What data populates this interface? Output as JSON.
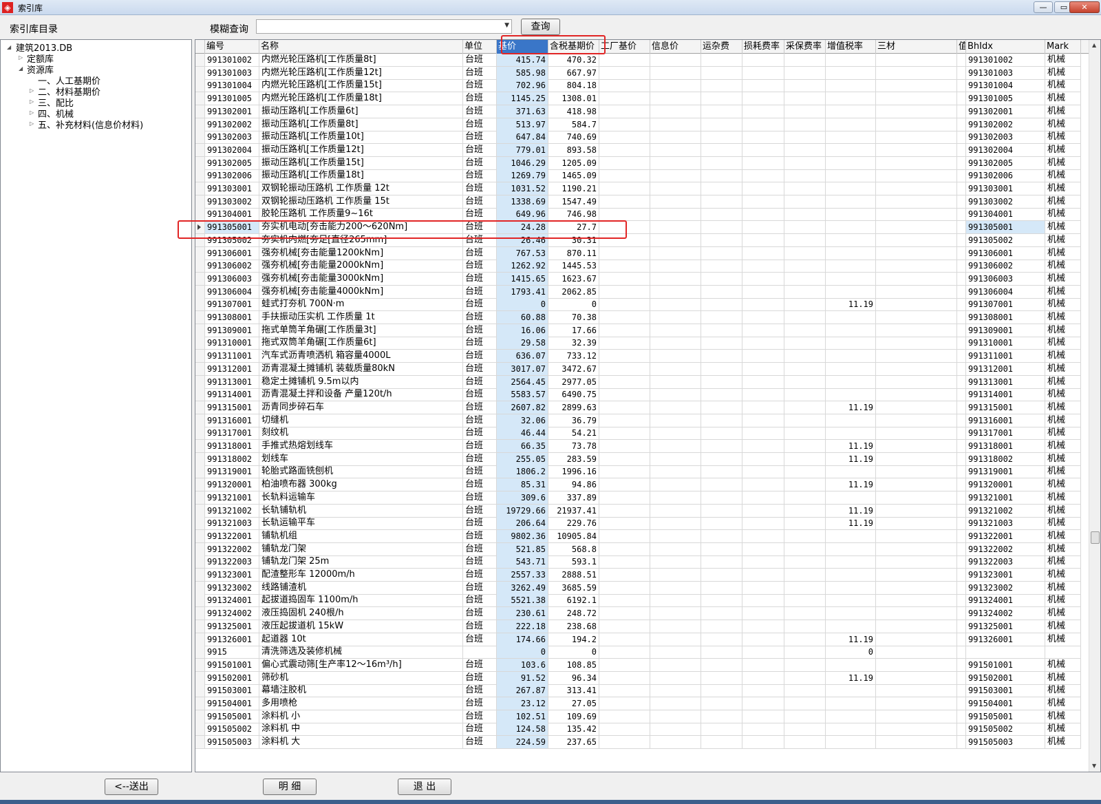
{
  "window": {
    "title": "索引库",
    "minimize": "—",
    "maximize": "▭",
    "close": "✕"
  },
  "toolbar": {
    "dir_label": "索引库目录",
    "fuzzy_label": "模糊查询",
    "fuzzy_value": "",
    "query_button": "查询"
  },
  "tree": {
    "root": "建筑2013.DB",
    "nodes": [
      {
        "label": "定额库",
        "level": 1,
        "arrow": "▷"
      },
      {
        "label": "资源库",
        "level": 1,
        "arrow": "◢"
      },
      {
        "label": "一、人工基期价",
        "level": 2,
        "arrow": ""
      },
      {
        "label": "二、材料基期价",
        "level": 2,
        "arrow": "▷"
      },
      {
        "label": "三、配比",
        "level": 2,
        "arrow": "▷"
      },
      {
        "label": "四、机械",
        "level": 2,
        "arrow": "▷"
      },
      {
        "label": "五、补充材料(信息价材料)",
        "level": 2,
        "arrow": "▷"
      }
    ]
  },
  "grid": {
    "columns": [
      "编号",
      "名称",
      "单位",
      "基价",
      "含税基期价",
      "工厂基价",
      "信息价",
      "运杂费",
      "损耗费率",
      "采保费率",
      "增值税率",
      "三材",
      "值",
      "BhIdx",
      "Mark"
    ],
    "selected_column": "基价",
    "current_row": 13,
    "rows": [
      [
        "991301002",
        "内燃光轮压路机[工作质量8t]",
        "台班",
        "415.74",
        "470.32",
        "",
        "991301002",
        "机械"
      ],
      [
        "991301003",
        "内燃光轮压路机[工作质量12t]",
        "台班",
        "585.98",
        "667.97",
        "",
        "991301003",
        "机械"
      ],
      [
        "991301004",
        "内燃光轮压路机[工作质量15t]",
        "台班",
        "702.96",
        "804.18",
        "",
        "991301004",
        "机械"
      ],
      [
        "991301005",
        "内燃光轮压路机[工作质量18t]",
        "台班",
        "1145.25",
        "1308.01",
        "",
        "991301005",
        "机械"
      ],
      [
        "991302001",
        "振动压路机[工作质量6t]",
        "台班",
        "371.63",
        "418.98",
        "",
        "991302001",
        "机械"
      ],
      [
        "991302002",
        "振动压路机[工作质量8t]",
        "台班",
        "513.97",
        "584.7",
        "",
        "991302002",
        "机械"
      ],
      [
        "991302003",
        "振动压路机[工作质量10t]",
        "台班",
        "647.84",
        "740.69",
        "",
        "991302003",
        "机械"
      ],
      [
        "991302004",
        "振动压路机[工作质量12t]",
        "台班",
        "779.01",
        "893.58",
        "",
        "991302004",
        "机械"
      ],
      [
        "991302005",
        "振动压路机[工作质量15t]",
        "台班",
        "1046.29",
        "1205.09",
        "",
        "991302005",
        "机械"
      ],
      [
        "991302006",
        "振动压路机[工作质量18t]",
        "台班",
        "1269.79",
        "1465.09",
        "",
        "991302006",
        "机械"
      ],
      [
        "991303001",
        "双钢轮振动压路机 工作质量 12t",
        "台班",
        "1031.52",
        "1190.21",
        "",
        "991303001",
        "机械"
      ],
      [
        "991303002",
        "双钢轮振动压路机 工作质量 15t",
        "台班",
        "1338.69",
        "1547.49",
        "",
        "991303002",
        "机械"
      ],
      [
        "991304001",
        "胶轮压路机 工作质量9~16t",
        "台班",
        "649.96",
        "746.98",
        "",
        "991304001",
        "机械"
      ],
      [
        "991305001",
        "夯实机电动[夯击能力200～620Nm]",
        "台班",
        "24.28",
        "27.7",
        "",
        "991305001",
        "机械"
      ],
      [
        "991305002",
        "夯实机内燃[夯足[直径265mm]",
        "台班",
        "26.46",
        "30.31",
        "",
        "991305002",
        "机械"
      ],
      [
        "991306001",
        "强夯机械[夯击能量1200kNm]",
        "台班",
        "767.53",
        "870.11",
        "",
        "991306001",
        "机械"
      ],
      [
        "991306002",
        "强夯机械[夯击能量2000kNm]",
        "台班",
        "1262.92",
        "1445.53",
        "",
        "991306002",
        "机械"
      ],
      [
        "991306003",
        "强夯机械[夯击能量3000kNm]",
        "台班",
        "1415.65",
        "1623.67",
        "",
        "991306003",
        "机械"
      ],
      [
        "991306004",
        "强夯机械[夯击能量4000kNm]",
        "台班",
        "1793.41",
        "2062.85",
        "",
        "991306004",
        "机械"
      ],
      [
        "991307001",
        "蛙式打夯机 700N·m",
        "台班",
        "0",
        "0",
        "11.19",
        "991307001",
        "机械"
      ],
      [
        "991308001",
        "手扶振动压实机 工作质量 1t",
        "台班",
        "60.88",
        "70.38",
        "",
        "991308001",
        "机械"
      ],
      [
        "991309001",
        "拖式单筒羊角碾[工作质量3t]",
        "台班",
        "16.06",
        "17.66",
        "",
        "991309001",
        "机械"
      ],
      [
        "991310001",
        "拖式双筒羊角碾[工作质量6t]",
        "台班",
        "29.58",
        "32.39",
        "",
        "991310001",
        "机械"
      ],
      [
        "991311001",
        "汽车式沥青喷洒机 箱容量4000L",
        "台班",
        "636.07",
        "733.12",
        "",
        "991311001",
        "机械"
      ],
      [
        "991312001",
        "沥青混凝土摊铺机 装载质量80kN",
        "台班",
        "3017.07",
        "3472.67",
        "",
        "991312001",
        "机械"
      ],
      [
        "991313001",
        "稳定土摊铺机 9.5m以内",
        "台班",
        "2564.45",
        "2977.05",
        "",
        "991313001",
        "机械"
      ],
      [
        "991314001",
        "沥青混凝土拌和设备 产量120t/h",
        "台班",
        "5583.57",
        "6490.75",
        "",
        "991314001",
        "机械"
      ],
      [
        "991315001",
        "沥青同步碎石车",
        "台班",
        "2607.82",
        "2899.63",
        "11.19",
        "991315001",
        "机械"
      ],
      [
        "991316001",
        "切缝机",
        "台班",
        "32.06",
        "36.79",
        "",
        "991316001",
        "机械"
      ],
      [
        "991317001",
        "刻纹机",
        "台班",
        "46.44",
        "54.21",
        "",
        "991317001",
        "机械"
      ],
      [
        "991318001",
        "手推式热熔划线车",
        "台班",
        "66.35",
        "73.78",
        "11.19",
        "991318001",
        "机械"
      ],
      [
        "991318002",
        "划线车",
        "台班",
        "255.05",
        "283.59",
        "11.19",
        "991318002",
        "机械"
      ],
      [
        "991319001",
        "轮胎式路面铣刨机",
        "台班",
        "1806.2",
        "1996.16",
        "",
        "991319001",
        "机械"
      ],
      [
        "991320001",
        "柏油喷布器 300kg",
        "台班",
        "85.31",
        "94.86",
        "11.19",
        "991320001",
        "机械"
      ],
      [
        "991321001",
        "长轨料运输车",
        "台班",
        "309.6",
        "337.89",
        "",
        "991321001",
        "机械"
      ],
      [
        "991321002",
        "长轨铺轨机",
        "台班",
        "19729.66",
        "21937.41",
        "11.19",
        "991321002",
        "机械"
      ],
      [
        "991321003",
        "长轨运输平车",
        "台班",
        "206.64",
        "229.76",
        "11.19",
        "991321003",
        "机械"
      ],
      [
        "991322001",
        "铺轨机组",
        "台班",
        "9802.36",
        "10905.84",
        "",
        "991322001",
        "机械"
      ],
      [
        "991322002",
        "铺轨龙门架",
        "台班",
        "521.85",
        "568.8",
        "",
        "991322002",
        "机械"
      ],
      [
        "991322003",
        "铺轨龙门架 25m",
        "台班",
        "543.71",
        "593.1",
        "",
        "991322003",
        "机械"
      ],
      [
        "991323001",
        "配渣整形车 12000m/h",
        "台班",
        "2557.33",
        "2888.51",
        "",
        "991323001",
        "机械"
      ],
      [
        "991323002",
        "线路铺渣机",
        "台班",
        "3262.49",
        "3685.59",
        "",
        "991323002",
        "机械"
      ],
      [
        "991324001",
        "起拔道捣固车 1100m/h",
        "台班",
        "5521.38",
        "6192.1",
        "",
        "991324001",
        "机械"
      ],
      [
        "991324002",
        "液压捣固机 240根/h",
        "台班",
        "230.61",
        "248.72",
        "",
        "991324002",
        "机械"
      ],
      [
        "991325001",
        "液压起拔道机 15kW",
        "台班",
        "222.18",
        "238.68",
        "",
        "991325001",
        "机械"
      ],
      [
        "991326001",
        "起道器 10t",
        "台班",
        "174.66",
        "194.2",
        "11.19",
        "991326001",
        "机械"
      ],
      [
        "9915",
        "清洗筛选及装修机械",
        "",
        "0",
        "0",
        "0",
        "",
        ""
      ],
      [
        "991501001",
        "偏心式震动筛[生产率12～16m³/h]",
        "台班",
        "103.6",
        "108.85",
        "",
        "991501001",
        "机械"
      ],
      [
        "991502001",
        "筛砂机",
        "台班",
        "91.52",
        "96.34",
        "11.19",
        "991502001",
        "机械"
      ],
      [
        "991503001",
        "幕墙注胶机",
        "台班",
        "267.87",
        "313.41",
        "",
        "991503001",
        "机械"
      ],
      [
        "991504001",
        "多用喷枪",
        "台班",
        "23.12",
        "27.05",
        "",
        "991504001",
        "机械"
      ],
      [
        "991505001",
        "涂料机 小",
        "台班",
        "102.51",
        "109.69",
        "",
        "991505001",
        "机械"
      ],
      [
        "991505002",
        "涂料机 中",
        "台班",
        "124.58",
        "135.42",
        "",
        "991505002",
        "机械"
      ],
      [
        "991505003",
        "涂料机 大",
        "台班",
        "224.59",
        "237.65",
        "",
        "991505003",
        "机械"
      ]
    ]
  },
  "footer": {
    "send_button": "<--送出",
    "detail_button": "明 细",
    "exit_button": "退 出"
  },
  "colors": {
    "highlight_box": "#e12424",
    "selected_header": "#3a76c8",
    "base_price_column": "#d5e8f8"
  }
}
